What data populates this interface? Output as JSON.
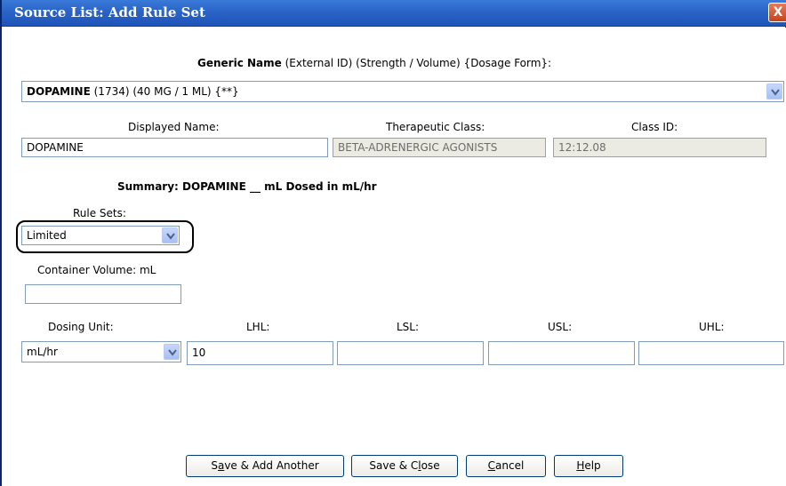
{
  "window": {
    "title": "Source List: Add Rule Set",
    "close_glyph": "X"
  },
  "generic": {
    "header_bold": "Generic Name",
    "header_rest": "(External ID)  (Strength / Volume)  {Dosage Form}:",
    "selected_bold": "DOPAMINE",
    "selected_rest": "(1734)  (40 MG / 1 ML)  {**}"
  },
  "fields": {
    "displayed_name_label": "Displayed Name:",
    "displayed_name_value": "DOPAMINE",
    "therapeutic_class_label": "Therapeutic Class:",
    "therapeutic_class_value": "BETA-ADRENERGIC AGONISTS",
    "class_id_label": "Class ID:",
    "class_id_value": "12:12.08"
  },
  "summary": "Summary:  DOPAMINE __ mL Dosed in mL/hr",
  "rule_sets": {
    "label": "Rule Sets:",
    "value": "Limited"
  },
  "container_volume": {
    "label": "Container Volume: mL",
    "value": ""
  },
  "dosing": {
    "unit_label": "Dosing Unit:",
    "unit_value": "mL/hr",
    "lhl_label": "LHL:",
    "lhl_value": "10",
    "lsl_label": "LSL:",
    "lsl_value": "",
    "usl_label": "USL:",
    "usl_value": "",
    "uhl_label": "UHL:",
    "uhl_value": ""
  },
  "buttons": {
    "save_add": {
      "pre": "S",
      "u": "a",
      "post": "ve & Add Another"
    },
    "save_close": {
      "pre": "Save & C",
      "u": "l",
      "post": "ose"
    },
    "cancel": {
      "pre": "",
      "u": "C",
      "post": "ancel"
    },
    "help": {
      "pre": "",
      "u": "H",
      "post": "elp"
    }
  },
  "icons": {
    "dropdown": "chevron-down-icon",
    "close": "close-icon"
  },
  "colors": {
    "titlebar": "#2a63c8",
    "field_border": "#7f9db9",
    "disabled_bg": "#ebebe4"
  }
}
